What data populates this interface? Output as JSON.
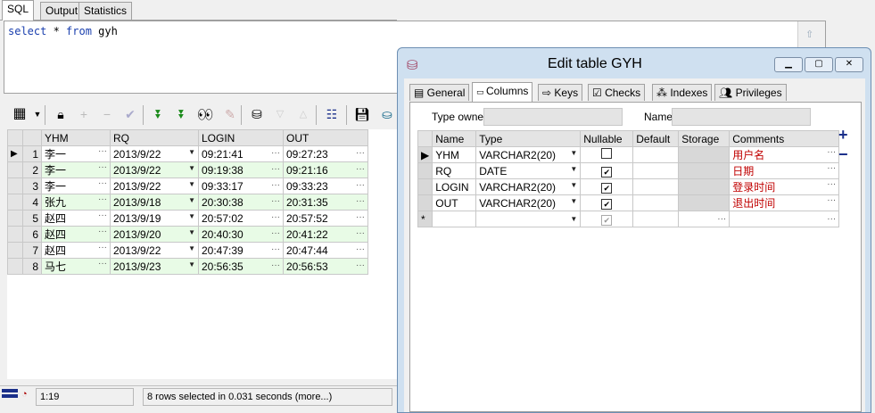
{
  "tabs": [
    "SQL",
    "Output",
    "Statistics"
  ],
  "sql": {
    "kw1": "select",
    "rest1": " * ",
    "kw2": "from",
    "rest2": " gyh"
  },
  "toolbar_icons": [
    "grid-icon",
    "lock-icon",
    "add-icon",
    "delete-icon",
    "post-icon",
    "next-icon",
    "last-icon",
    "find-icon",
    "clear-icon",
    "query-icon",
    "down-icon",
    "up-icon",
    "tree-icon",
    "save-icon",
    "export-icon"
  ],
  "grid": {
    "columns": [
      "YHM",
      "RQ",
      "LOGIN",
      "OUT"
    ],
    "rows": [
      {
        "n": "1",
        "yhm": "李一",
        "rq": "2013/9/22",
        "login": "09:21:41",
        "out": "09:27:23"
      },
      {
        "n": "2",
        "yhm": "李一",
        "rq": "2013/9/22",
        "login": "09:19:38",
        "out": "09:21:16"
      },
      {
        "n": "3",
        "yhm": "李一",
        "rq": "2013/9/22",
        "login": "09:33:17",
        "out": "09:33:23"
      },
      {
        "n": "4",
        "yhm": "张九",
        "rq": "2013/9/18",
        "login": "20:30:38",
        "out": "20:31:35"
      },
      {
        "n": "5",
        "yhm": "赵四",
        "rq": "2013/9/19",
        "login": "20:57:02",
        "out": "20:57:52"
      },
      {
        "n": "6",
        "yhm": "赵四",
        "rq": "2013/9/20",
        "login": "20:40:30",
        "out": "20:41:22"
      },
      {
        "n": "7",
        "yhm": "赵四",
        "rq": "2013/9/22",
        "login": "20:47:39",
        "out": "20:47:44"
      },
      {
        "n": "8",
        "yhm": "马七",
        "rq": "2013/9/23",
        "login": "20:56:35",
        "out": "20:56:53"
      }
    ]
  },
  "status": {
    "position": "1:19",
    "message": "8 rows selected in 0.031 seconds (more...)"
  },
  "dialog": {
    "title": "Edit table GYH",
    "tabs": [
      "General",
      "Columns",
      "Keys",
      "Checks",
      "Indexes",
      "Privileges"
    ],
    "type_owner_label": "Type owner",
    "name_label": "Name",
    "columns_header": [
      "Name",
      "Type",
      "Nullable",
      "Default",
      "Storage",
      "Comments"
    ],
    "columns": [
      {
        "name": "YHM",
        "type": "VARCHAR2(20)",
        "nullable": false,
        "comment": "用户名"
      },
      {
        "name": "RQ",
        "type": "DATE",
        "nullable": true,
        "comment": "日期"
      },
      {
        "name": "LOGIN",
        "type": "VARCHAR2(20)",
        "nullable": true,
        "comment": " 登录时间"
      },
      {
        "name": "OUT",
        "type": "VARCHAR2(20)",
        "nullable": true,
        "comment": "退出时间"
      }
    ],
    "new_row_marker": "*",
    "add_symbol": "+",
    "remove_symbol": "−"
  },
  "colors": {
    "accent": "#1a2f8a",
    "comment": "#c00000",
    "row_alt": "#e8fbe6"
  }
}
